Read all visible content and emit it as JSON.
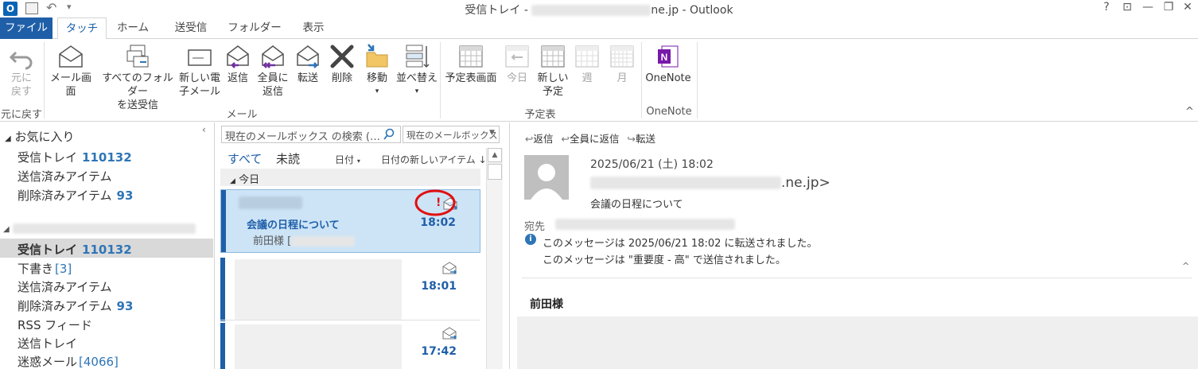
{
  "window": {
    "title_prefix": "受信トレイ - ",
    "title_suffix": "ne.jp - Outlook",
    "controls": {
      "help": "?",
      "restore_ribbon": "⊡",
      "minimize": "—",
      "maximize": "❐",
      "close": "✕"
    }
  },
  "tabs": [
    "ファイル",
    "タッチ",
    "ホーム",
    "送受信",
    "フォルダー",
    "表示"
  ],
  "ribbon": {
    "undo": {
      "line1": "元に",
      "line2": "戻す",
      "group": "元に戻す"
    },
    "mail_view": "メール画面",
    "send_receive_all": {
      "line1": "すべてのフォルダー",
      "line2": "を送受信"
    },
    "new_mail": {
      "line1": "新しい電",
      "line2": "子メール"
    },
    "reply": "返信",
    "reply_all": {
      "line1": "全員に",
      "line2": "返信"
    },
    "forward": "転送",
    "delete": "削除",
    "move": "移動",
    "sort": "並べ替え",
    "mail_group": "メール",
    "calendar_view": "予定表画面",
    "today": "今日",
    "new_appointment": {
      "line1": "新しい",
      "line2": "予定"
    },
    "week": "週",
    "month": "月",
    "calendar_group": "予定表",
    "onenote": "OneNote",
    "onenote_group": "OneNote",
    "collapse": "^"
  },
  "nav": {
    "favorites": "お気に入り",
    "fav_items": [
      {
        "label": "受信トレイ",
        "count": "110132"
      },
      {
        "label": "送信済みアイテム",
        "count": ""
      },
      {
        "label": "削除済みアイテム",
        "count": "93"
      }
    ],
    "account_items": [
      {
        "label": "受信トレイ",
        "count": "110132"
      },
      {
        "label": "下書き",
        "count": "[3]"
      },
      {
        "label": "送信済みアイテム",
        "count": ""
      },
      {
        "label": "削除済みアイテム",
        "count": "93"
      },
      {
        "label": "RSS フィード",
        "count": ""
      },
      {
        "label": "送信トレイ",
        "count": ""
      },
      {
        "label": "迷惑メール",
        "count": "[4066]"
      }
    ]
  },
  "list": {
    "search_placeholder": "現在のメールボックス の検索 (…",
    "scope": "現在のメールボックス",
    "filter_all": "すべて",
    "filter_unread": "未読",
    "sort_by": "日付",
    "sort_order": "日付の新しいアイテム ↓",
    "group_today": "今日",
    "messages": [
      {
        "subject": "会議の日程について",
        "preview": "前田様 [",
        "time": "18:02",
        "importance": "!"
      },
      {
        "subject": "",
        "preview": "",
        "time": "18:01",
        "importance": ""
      },
      {
        "subject": "",
        "preview": "",
        "time": "17:42",
        "importance": ""
      }
    ]
  },
  "reading": {
    "reply": "返信",
    "reply_all": "全員に返信",
    "forward": "転送",
    "datetime": "2025/06/21 (土) 18:02",
    "sender_suffix": ".ne.jp>",
    "subject": "会議の日程について",
    "to_label": "宛先",
    "info1": "このメッセージは 2025/06/21 18:02 に転送されました。",
    "info2": "このメッセージは \"重要度 - 高\" で送信されました。",
    "body_greeting": "前田様"
  },
  "colors": {
    "accent": "#1f5fa8",
    "count": "#2e75b6",
    "selected": "#cde4f7",
    "highlight_circle": "#e01010"
  }
}
